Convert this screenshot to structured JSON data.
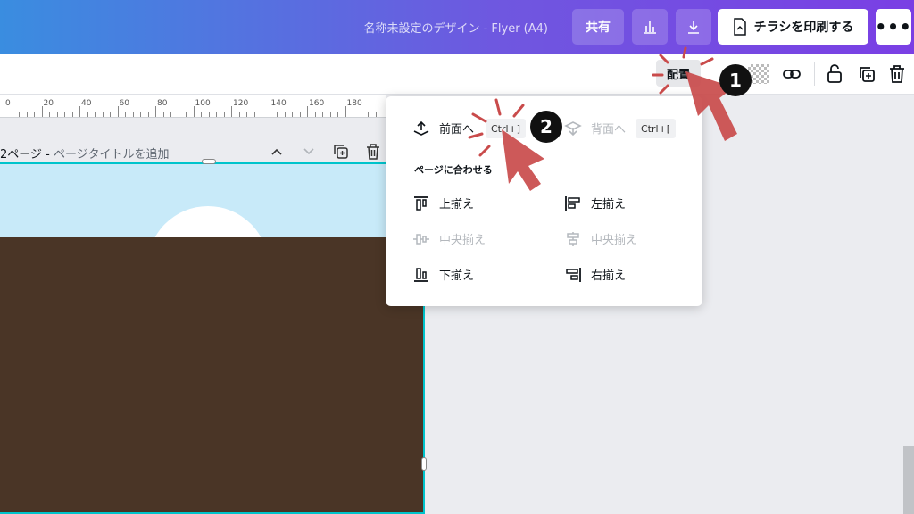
{
  "header": {
    "doc_title": "名称未設定のデザイン - Flyer (A4)",
    "share_label": "共有",
    "stats_icon": "bar-chart-icon",
    "download_icon": "download-icon",
    "print_label": "チラシを印刷する",
    "more_label": "•••"
  },
  "toolbar": {
    "arrange_label": "配置"
  },
  "ruler": [
    "0",
    "20",
    "40",
    "60",
    "80",
    "100",
    "120",
    "140",
    "160",
    "180"
  ],
  "page": {
    "prefix": "2ページ - ",
    "title_placeholder": "ページタイトルを追加"
  },
  "popup": {
    "forward_label": "前面へ",
    "forward_shortcut": "Ctrl+]",
    "backward_label": "背面へ",
    "backward_shortcut": "Ctrl+[",
    "section_label": "ページに合わせる",
    "top_label": "上揃え",
    "left_label": "左揃え",
    "middle_label": "中央揃え",
    "center_label": "中央揃え",
    "bottom_label": "下揃え",
    "right_label": "右揃え"
  },
  "annotations": {
    "step1": "1",
    "step2": "2"
  },
  "colors": {
    "accent": "#7a3fe4",
    "selection": "#00c4cc",
    "ground": "#4a3526",
    "sky": "#c8eaf9",
    "callout": "#c94b4b"
  }
}
